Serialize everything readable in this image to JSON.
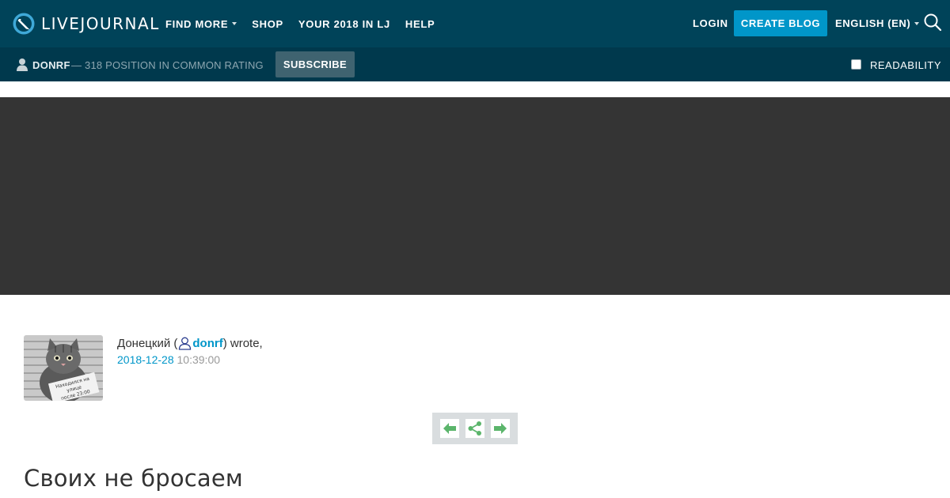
{
  "header": {
    "logo_text": "LIVEJOURNAL",
    "nav": [
      {
        "label": "FIND MORE",
        "has_dropdown": true
      },
      {
        "label": "SHOP",
        "has_dropdown": false
      },
      {
        "label": "YOUR 2018 IN LJ",
        "has_dropdown": false
      },
      {
        "label": "HELP",
        "has_dropdown": false
      }
    ],
    "login_label": "LOGIN",
    "create_blog_label": "CREATE BLOG",
    "language_label": "ENGLISH (EN)",
    "search_icon": "search-icon"
  },
  "journal_bar": {
    "username": "DONRF",
    "rating_text": "— 318 POSITION IN COMMON RATING",
    "subscribe_label": "SUBSCRIBE",
    "readability_label": "READABILITY",
    "readability_checked": false
  },
  "post": {
    "author_name": "Донецкий (",
    "author_username": "donrf",
    "author_suffix": ") wrote,",
    "date": "2018-12-28",
    "time": "10:39:00",
    "avatar_sign_text": "Находился на улице после 23:00",
    "title": "Своих не бросаем"
  },
  "colors": {
    "topbar": "#004359",
    "subbar": "#00394d",
    "accent": "#0096c9",
    "banner": "#343434",
    "nav_arrow": "#5bb56b"
  }
}
